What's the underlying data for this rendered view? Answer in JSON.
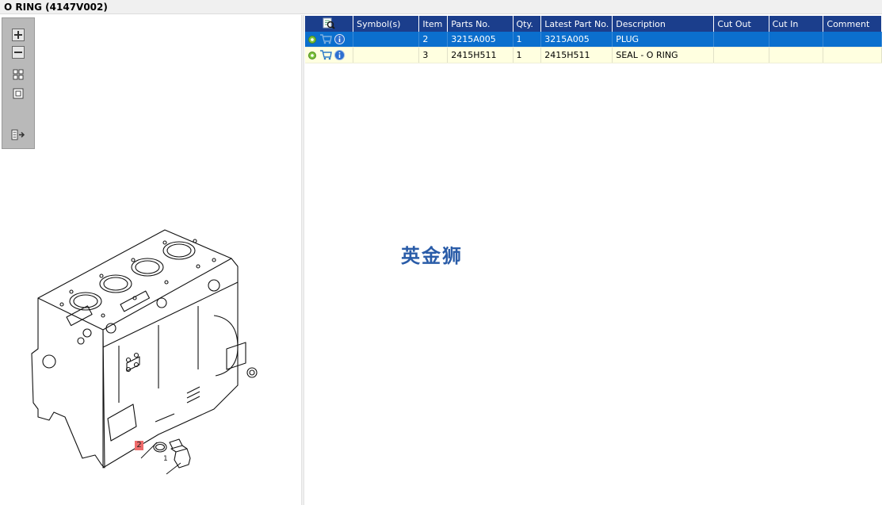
{
  "window": {
    "title": "O RING (4147V002)"
  },
  "toolbox": {
    "buttons": [
      "zoom-in",
      "zoom-out",
      "fit-all",
      "actual-size",
      "export-list"
    ]
  },
  "drawing": {
    "callouts": [
      {
        "label": "2",
        "highlighted": true
      },
      {
        "label": "1",
        "highlighted": false
      }
    ]
  },
  "table": {
    "headers": [
      "Symbol(s)",
      "Item",
      "Parts No.",
      "Qty.",
      "Latest Part No.",
      "Description",
      "Cut Out",
      "Cut In",
      "Comment"
    ],
    "rows": [
      {
        "selected": true,
        "symbols": "",
        "item": "2",
        "parts_no": "3215A005",
        "qty": "1",
        "latest_part_no": "3215A005",
        "description": "PLUG",
        "cut_out": "",
        "cut_in": "",
        "comment": ""
      },
      {
        "selected": false,
        "symbols": "",
        "item": "3",
        "parts_no": "2415H511",
        "qty": "1",
        "latest_part_no": "2415H511",
        "description": "SEAL - O RING",
        "cut_out": "",
        "cut_in": "",
        "comment": ""
      }
    ]
  },
  "watermark": {
    "text": "英金狮"
  },
  "colors": {
    "header_bg": "#1b3e8c",
    "selected_row_bg": "#0b6fce",
    "row_bg": "#ffffe0",
    "callout_highlight": "#ef6b6b",
    "watermark": "#2a5ca8"
  },
  "icons": [
    "gear-icon",
    "cart-icon",
    "info-icon",
    "search-list-icon"
  ]
}
